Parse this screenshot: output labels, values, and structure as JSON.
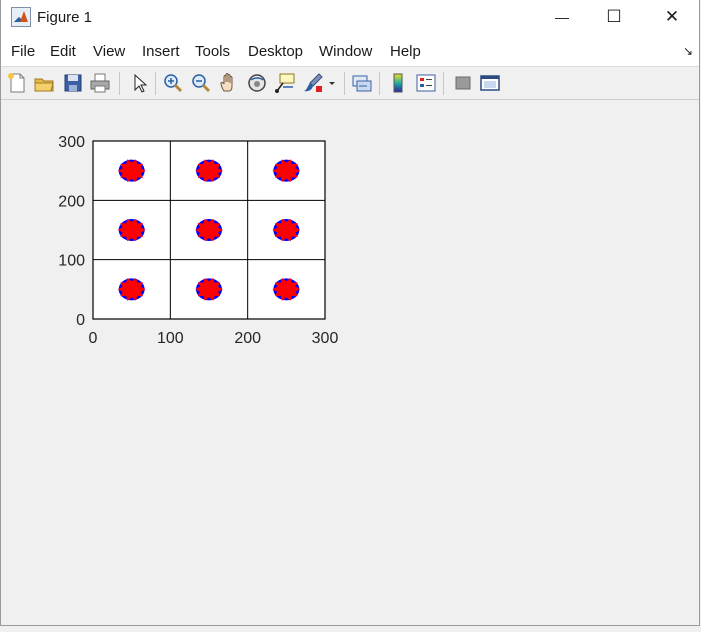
{
  "window": {
    "title": "Figure 1",
    "minimize_glyph": "—",
    "maximize_glyph": "☐",
    "close_glyph": "✕"
  },
  "menu": {
    "items": [
      "File",
      "Edit",
      "View",
      "Insert",
      "Tools",
      "Desktop",
      "Window",
      "Help"
    ]
  },
  "toolbar": {
    "icons": [
      "new-figure-icon",
      "open-file-icon",
      "save-icon",
      "print-icon",
      "edit-plot-icon",
      "zoom-in-icon",
      "zoom-out-icon",
      "pan-icon",
      "rotate-3d-icon",
      "data-cursor-icon",
      "brush-icon",
      "brush-dropdown-icon",
      "link-plot-icon",
      "colorbar-icon",
      "legend-icon",
      "hide-plot-tools-icon",
      "show-plot-tools-icon"
    ]
  },
  "colors": {
    "marker_red": "#ff0000",
    "marker_blue": "#0000ff",
    "axes_line": "#000000"
  },
  "chart_data": {
    "type": "scatter",
    "title": "",
    "xlabel": "",
    "ylabel": "",
    "xlim": [
      0,
      300
    ],
    "ylim": [
      0,
      300
    ],
    "xticks": [
      0,
      100,
      200,
      300
    ],
    "yticks": [
      0,
      100,
      200,
      300
    ],
    "xtick_labels": [
      "0",
      "100",
      "200",
      "300"
    ],
    "ytick_labels": [
      "0",
      "100",
      "200",
      "300"
    ],
    "grid": true,
    "series": [
      {
        "x": [
          50,
          150,
          250,
          50,
          150,
          250,
          50,
          150,
          250
        ],
        "y": [
          50,
          50,
          50,
          150,
          150,
          150,
          250,
          250,
          250
        ]
      }
    ]
  }
}
